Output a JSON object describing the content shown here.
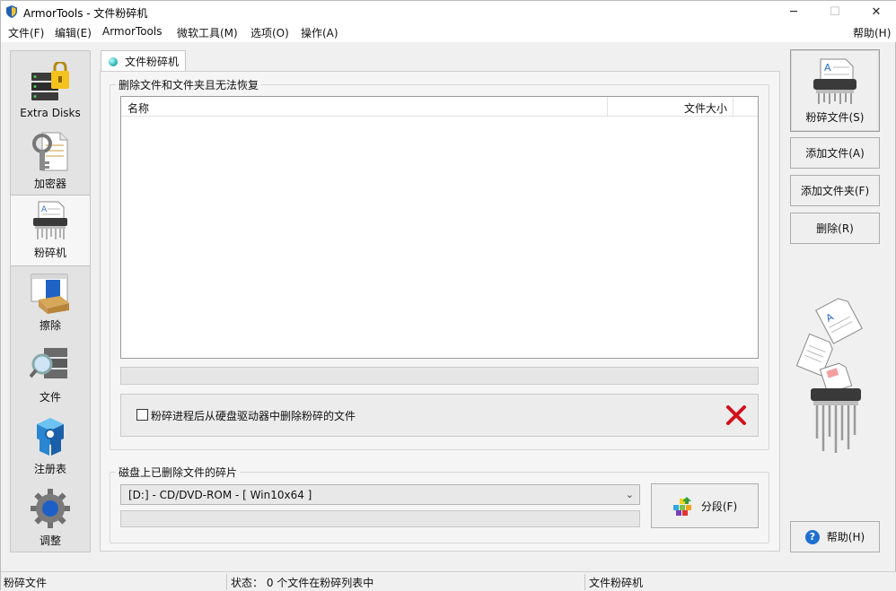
{
  "window": {
    "title": "ArmorTools - 文件粉碎机",
    "min_glyph": "─",
    "max_glyph": "☐",
    "close_glyph": "✕"
  },
  "menu": {
    "left": [
      "文件(F)",
      "编辑(E)",
      "ArmorTools",
      "微软工具(M)",
      "选项(O)",
      "操作(A)"
    ],
    "right": "帮助(H)"
  },
  "sidebar": {
    "items": [
      {
        "label": "Extra Disks",
        "icon": "disk-lock-icon"
      },
      {
        "label": "加密器",
        "icon": "key-document-icon"
      },
      {
        "label": "粉碎机",
        "icon": "shredder-icon",
        "active": true
      },
      {
        "label": "擦除",
        "icon": "eraser-box-icon"
      },
      {
        "label": "文件",
        "icon": "file-search-icon"
      },
      {
        "label": "注册表",
        "icon": "registry-cubes-icon"
      },
      {
        "label": "调整",
        "icon": "gear-icon"
      }
    ]
  },
  "tab": {
    "label": "文件粉碎机"
  },
  "shred_group": {
    "title": "删除文件和文件夹且无法恢复",
    "columns": [
      "名称",
      "文件大小"
    ],
    "rows": [],
    "progress": 0,
    "option_label": "粉碎进程后从硬盘驱动器中删除粉碎的文件",
    "option_checked": false
  },
  "disk_group": {
    "title": "磁盘上已删除文件的碎片",
    "selected_disk": "[D:] - CD/DVD-ROM - [ Win10x64 ]",
    "progress": 0,
    "defrag_label": "分段(F)"
  },
  "actions": {
    "shred_label": "粉碎文件(S)",
    "add_file_label": "添加文件(A)",
    "add_folder_label": "添加文件夹(F)",
    "delete_label": "删除(R)",
    "help_label": "帮助(H)"
  },
  "status": {
    "left": "粉碎文件",
    "middle": "状态：  0 个文件在粉碎列表中",
    "right": "文件粉碎机"
  },
  "colors": {
    "accent": "#1f6fd0",
    "cancel_red": "#d0121b"
  }
}
